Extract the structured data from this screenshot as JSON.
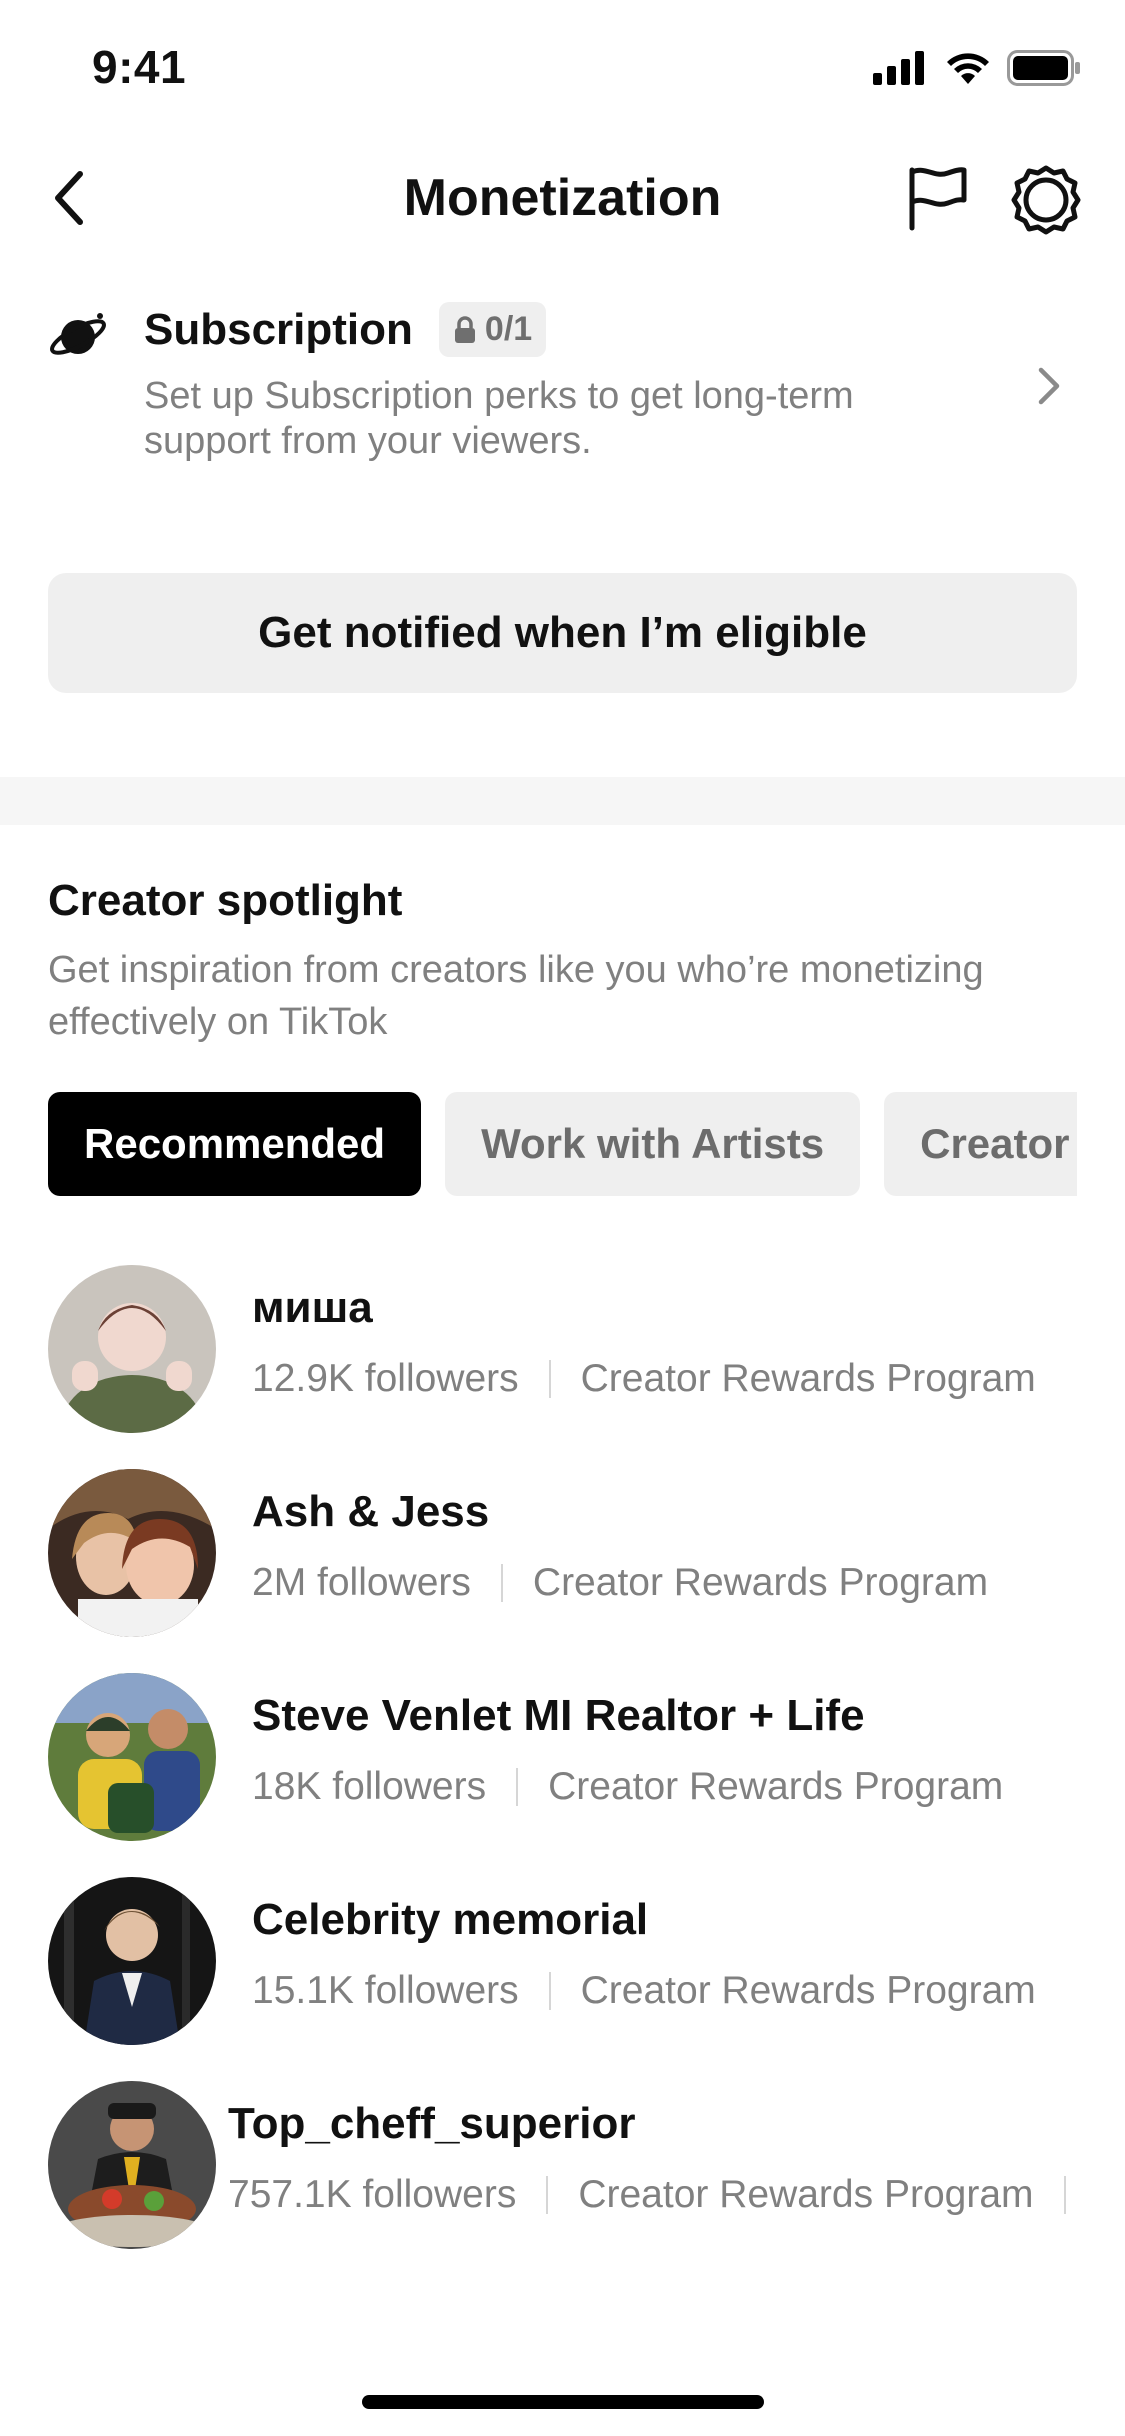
{
  "status_bar": {
    "time": "9:41"
  },
  "nav": {
    "title": "Monetization"
  },
  "subscription": {
    "title": "Subscription",
    "badge": "0/1",
    "description": "Set up Subscription perks to get long-term support from your viewers."
  },
  "notify_button": {
    "label": "Get notified when I’m eligible"
  },
  "spotlight": {
    "title": "Creator spotlight",
    "description": "Get inspiration from creators like you who’re monetizing effectively on TikTok",
    "tabs": [
      {
        "label": "Recommended",
        "active": true
      },
      {
        "label": "Work with Artists",
        "active": false
      },
      {
        "label": "Creator",
        "active": false
      }
    ]
  },
  "creators": [
    {
      "name": "миша",
      "followers": "12.9K followers",
      "program": "Creator Rewards Program"
    },
    {
      "name": "Ash & Jess",
      "followers": "2M followers",
      "program": "Creator Rewards Program"
    },
    {
      "name": "Steve Venlet MI Realtor + Life",
      "followers": "18K followers",
      "program": "Creator Rewards Program"
    },
    {
      "name": "Celebrity memorial",
      "followers": "15.1K followers",
      "program": "Creator Rewards Program"
    },
    {
      "name": "Top_cheff_superior",
      "followers": "757.1K followers",
      "program": "Creator Rewards Program"
    }
  ],
  "icons": {
    "back": "chevron-left-icon",
    "flag": "flag-icon",
    "settings": "gear-icon",
    "subscription": "planet-icon",
    "lock": "lock-icon",
    "chevron": "chevron-right-icon"
  }
}
